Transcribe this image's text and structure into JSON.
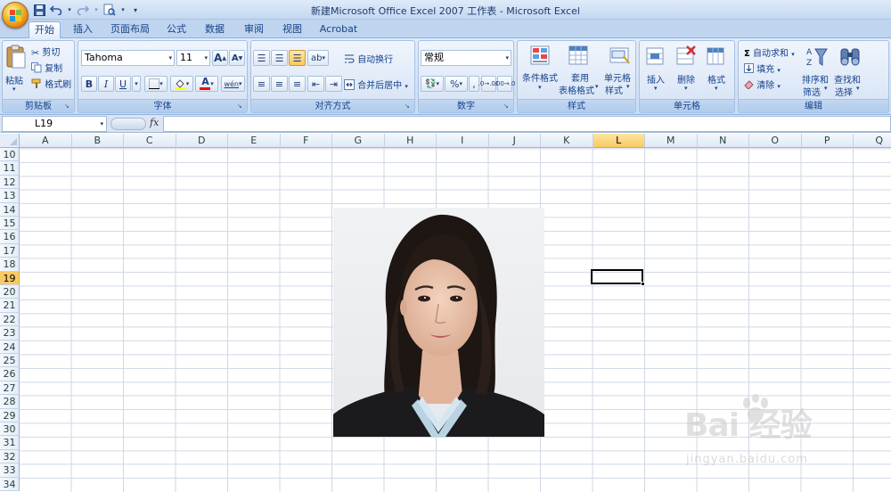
{
  "window": {
    "title": "新建Microsoft Office Excel 2007 工作表 - Microsoft Excel"
  },
  "quick_access": {
    "icons": [
      "save-icon",
      "undo-icon",
      "redo-icon",
      "print-preview-icon",
      "customize-arrow-icon"
    ]
  },
  "tabs": [
    {
      "label": "开始",
      "active": true
    },
    {
      "label": "插入"
    },
    {
      "label": "页面布局"
    },
    {
      "label": "公式"
    },
    {
      "label": "数据"
    },
    {
      "label": "审阅"
    },
    {
      "label": "视图"
    },
    {
      "label": "Acrobat"
    }
  ],
  "ribbon": {
    "clipboard": {
      "label": "剪贴板",
      "paste": "粘贴",
      "cut": "剪切",
      "copy": "复制",
      "format_painter": "格式刷"
    },
    "font": {
      "label": "字体",
      "font_name": "Tahoma",
      "font_size": "11",
      "bold": "B",
      "italic": "I",
      "underline": "U",
      "grow": "A",
      "shrink": "A",
      "font_color_glyph": "A",
      "phonetic": "wén"
    },
    "alignment": {
      "label": "对齐方式",
      "wrap_text": "自动换行",
      "merge_center": "合并后居中"
    },
    "number": {
      "label": "数字",
      "format": "常规",
      "percent": "%",
      "comma": ",",
      "inc_decimal": ".0→.00",
      "dec_decimal": ".00→.0"
    },
    "styles": {
      "label": "样式",
      "conditional_1": "条件格式",
      "table_1": "套用",
      "table_2": "表格格式",
      "cell_1": "单元格",
      "cell_2": "样式"
    },
    "cells": {
      "label": "单元格",
      "insert": "插入",
      "delete": "删除",
      "format": "格式"
    },
    "editing": {
      "label": "编辑",
      "autosum": "自动求和",
      "fill": "填充",
      "clear": "清除",
      "sort_1": "排序和",
      "sort_2": "筛选",
      "find_1": "查找和",
      "find_2": "选择"
    }
  },
  "formula_bar": {
    "name_box": "L19",
    "fx": "fx",
    "value": ""
  },
  "grid": {
    "columns": [
      "A",
      "B",
      "C",
      "D",
      "E",
      "F",
      "G",
      "H",
      "I",
      "J",
      "K",
      "L",
      "M",
      "N",
      "O",
      "P",
      "Q"
    ],
    "rows": [
      "10",
      "11",
      "12",
      "13",
      "14",
      "15",
      "16",
      "17",
      "18",
      "19",
      "20",
      "21",
      "22",
      "23",
      "24",
      "25",
      "26",
      "27",
      "28",
      "29",
      "30",
      "31",
      "32",
      "33",
      "34"
    ],
    "selected_column": "L",
    "selected_row": "19"
  },
  "watermark": {
    "logo": "Bai 经验",
    "url": "jingyan.baidu.com"
  },
  "colors": {
    "ribbon_text": "#15428b",
    "selection_header": "#f9c963",
    "gridline": "#d0d7e5"
  }
}
